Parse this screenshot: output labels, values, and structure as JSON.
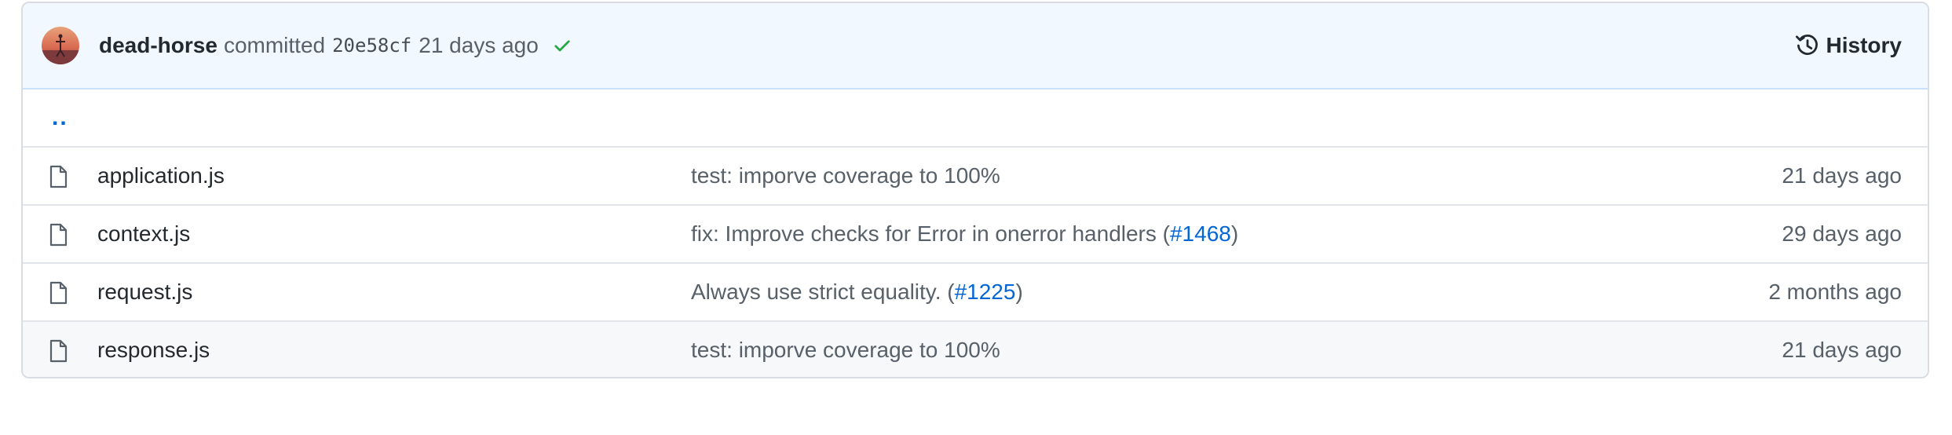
{
  "commit": {
    "author": "dead-horse",
    "verb": "committed",
    "sha": "20e58cf",
    "age": "21 days ago",
    "status_icon": "check-icon",
    "history_label": "History"
  },
  "updir_label": "..",
  "files": [
    {
      "name": "application.js",
      "message_prefix": "test: imporve coverage to 100%",
      "pr_link": "",
      "message_suffix": "",
      "age": "21 days ago"
    },
    {
      "name": "context.js",
      "message_prefix": "fix: Improve checks for Error in onerror handlers (",
      "pr_link": "#1468",
      "message_suffix": ")",
      "age": "29 days ago"
    },
    {
      "name": "request.js",
      "message_prefix": "Always use strict equality. (",
      "pr_link": "#1225",
      "message_suffix": ")",
      "age": "2 months ago"
    },
    {
      "name": "response.js",
      "message_prefix": "test: imporve coverage to 100%",
      "pr_link": "",
      "message_suffix": "",
      "age": "21 days ago"
    }
  ],
  "colors": {
    "header_bg": "#f1f8ff",
    "link": "#0366d6",
    "success": "#28a745",
    "border": "#e1e4e8"
  }
}
